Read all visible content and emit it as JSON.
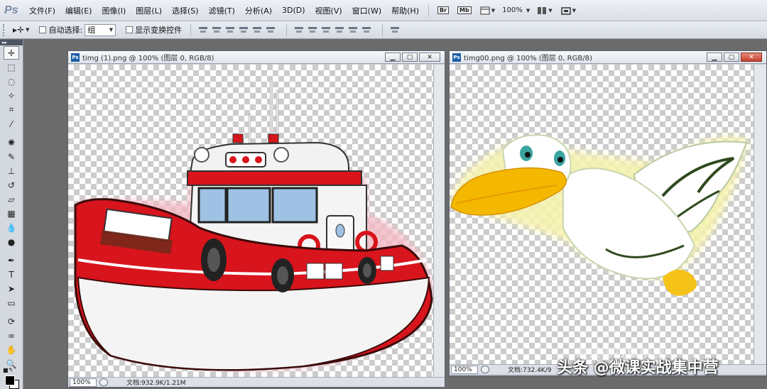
{
  "app": {
    "logo": "Ps"
  },
  "menu": [
    "文件(F)",
    "编辑(E)",
    "图像(I)",
    "图层(L)",
    "选择(S)",
    "滤镜(T)",
    "分析(A)",
    "3D(D)",
    "视图(V)",
    "窗口(W)",
    "帮助(H)"
  ],
  "menubar_buttons": {
    "bridge": "Br",
    "mini_bridge": "Mb",
    "zoom": "100%"
  },
  "options": {
    "auto_select_label": "自动选择:",
    "auto_select_value": "组",
    "show_transform_label": "显示变换控件"
  },
  "documents": [
    {
      "title": "timg (1).png @ 100% (图层 0, RGB/8)",
      "zoom": "100%",
      "doc_size": "文档:932.9K/1.21M"
    },
    {
      "title": "timg00.png @ 100% (图层 0, RGB/8)",
      "zoom": "100%",
      "doc_size": "文档:732.4K/9"
    }
  ],
  "watermark": {
    "text": "头条 @微课实战集中营",
    "faint_text": "微课实战集中营"
  },
  "colors": {
    "foreground": "#000000",
    "background": "#ffffff",
    "boat_red": "#d8141c",
    "pelican_beak": "#f5b800"
  }
}
